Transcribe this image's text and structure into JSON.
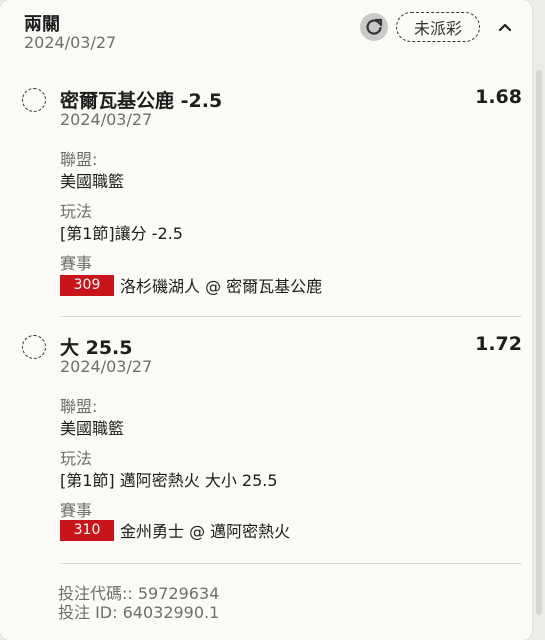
{
  "header": {
    "title": "兩關",
    "date": "2024/03/27",
    "status_label": "未派彩"
  },
  "legs": [
    {
      "selection": "密爾瓦基公鹿 -2.5",
      "odds": "1.68",
      "date": "2024/03/27",
      "league_label": "聯盟:",
      "league": "美國職籃",
      "bet_type_label": "玩法",
      "bet_type": "[第1節]讓分 -2.5",
      "event_label": "賽事",
      "match_id": "309",
      "match": "洛杉磯湖人 @ 密爾瓦基公鹿"
    },
    {
      "selection": "大 25.5",
      "odds": "1.72",
      "date": "2024/03/27",
      "league_label": "聯盟:",
      "league": "美國職籃",
      "bet_type_label": "玩法",
      "bet_type": "[第1節] 邁阿密熱火 大小 25.5",
      "event_label": "賽事",
      "match_id": "310",
      "match": "金州勇士 @ 邁阿密熱火"
    }
  ],
  "footer": {
    "bet_code": "投注代碼:: 59729634",
    "bet_id": "投注 ID: 64032990.1"
  },
  "icons": {
    "refresh": "refresh-icon",
    "collapse": "chevron-up-icon",
    "selection": "dashed-circle-icon"
  },
  "colors": {
    "match_badge": "#c8151b",
    "background": "#fbfaf6"
  }
}
